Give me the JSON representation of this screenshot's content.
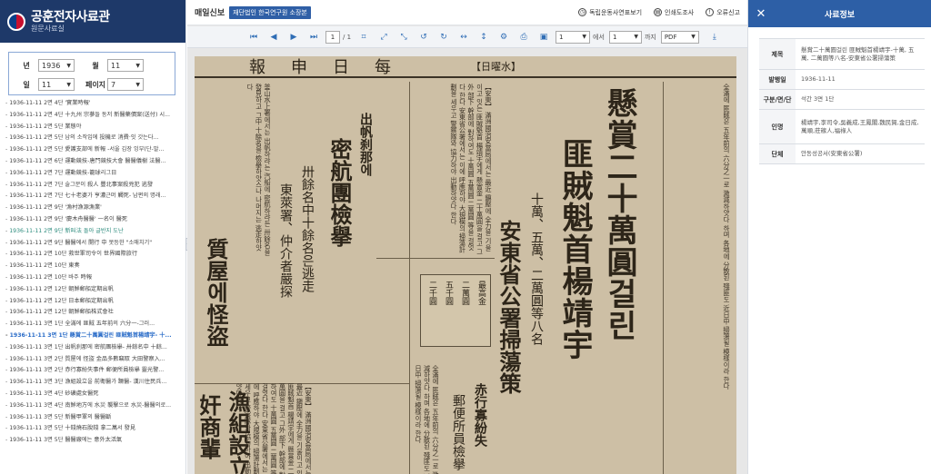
{
  "logo": {
    "title": "공훈전자사료관",
    "subtitle": "원문사료실"
  },
  "filters": {
    "year_label": "년",
    "year_value": "1936",
    "month_label": "월",
    "month_value": "11",
    "day_label": "일",
    "day_value": "11",
    "page_label": "페이지",
    "page_value": "7"
  },
  "articles": [
    {
      "text": "1936-11-11 2면 4단 '實業時報'",
      "state": "normal"
    },
    {
      "text": "1936-11-11 2면 4단 十九州 宗蔘들 동저 新醫藥價案(送付) 시...",
      "state": "normal"
    },
    {
      "text": "1936-11-11 2면 5단 業態야",
      "state": "normal"
    },
    {
      "text": "1936-11-11 2면 5단 남의 소작입에 投機로 消費·잇 갓는다...",
      "state": "normal"
    },
    {
      "text": "1936-11-11 2면 5단 愛護支部에 新報 -서울 김장 잉부(단-말...",
      "state": "normal"
    },
    {
      "text": "1936-11-11 2면 6단 運動競技-唐門競技大會 醫醫儀樹 法醫...",
      "state": "normal"
    },
    {
      "text": "1936-11-11 2면 7단 運動競技-籠球리그日",
      "state": "normal"
    },
    {
      "text": "1936-11-11 2면 7단 술그문이 殺人 豐北事案殺兇犯 逃發",
      "state": "normal"
    },
    {
      "text": "1936-11-11 2면 7단 七十老婆가 亨濃근머 觸死- 남편의 명래...",
      "state": "normal"
    },
    {
      "text": "1936-11-11 2면 9단 '漁村漁源漁業'",
      "state": "normal"
    },
    {
      "text": "1936-11-11 2면 9단 '慶木舟醫醫' 一名이 醫死",
      "state": "normal"
    },
    {
      "text": "1936-11-11 2면 9단 新叫法 돌아 글반지 도난",
      "state": "visited"
    },
    {
      "text": "1936-11-11 2면 9단 醫醫에서 開行 中 못등한 \"소매치기\"",
      "state": "normal"
    },
    {
      "text": "1936-11-11 2면 10단 救世軍司令이 世界國際旅行",
      "state": "normal"
    },
    {
      "text": "1936-11-11 2면 10단 東奏",
      "state": "normal"
    },
    {
      "text": "1936-11-11 2면 10단 바주 時報",
      "state": "normal"
    },
    {
      "text": "1936-11-11 2면 12단 朝鮮郵船定期出帆",
      "state": "normal"
    },
    {
      "text": "1936-11-11 2면 12단 日本郵船定期出帆",
      "state": "normal"
    },
    {
      "text": "1936-11-11 2면 12단 朝鮮郵船株式會社",
      "state": "normal"
    },
    {
      "text": "1936-11-11 3면 1단 全滿에 匪賊 五年前의 六分一-그러...",
      "state": "normal"
    },
    {
      "text": "1936-11-11 3면 1단 懸賞二十萬圓걸린 匪賊魁首楊靖宇- 十...",
      "state": "active"
    },
    {
      "text": "1936-11-11 3면 1단 出帆刹那에 密航團檢擧- 卅餘名中 十餘...",
      "state": "normal"
    },
    {
      "text": "1936-11-11 3면 2단 質屋에 怪盜 金品多數竊取 大田警察入...",
      "state": "normal"
    },
    {
      "text": "1936-11-11 3면 2단 赤行寡紛失事件 郵便所員檢擧 靈光警...",
      "state": "normal"
    },
    {
      "text": "1936-11-11 3면 3단 漁組設立을 前衛醫가 蹶醫- 漢川住民兵...",
      "state": "normal"
    },
    {
      "text": "1936-11-11 3면 4단 砂礦處女醫死",
      "state": "normal"
    },
    {
      "text": "1936-11-11 3면 4단 南鮮地方에 水災 襲撃으로 水災-醫醫의로...",
      "state": "normal"
    },
    {
      "text": "1936-11-11 3면 5단 新醫甲軍의 醫醫斷",
      "state": "normal"
    },
    {
      "text": "1936-11-11 3면 5단 十錢燒石脫錢 拿二萬서 發見",
      "state": "normal"
    },
    {
      "text": "1936-11-11 3면 5단 醫醫廠에는 意外太活氣",
      "state": "normal"
    }
  ],
  "center_header": {
    "paper_name": "매일신보",
    "source_badge": "재단법인 한국연구원 소장본",
    "links": [
      "독립운동사연표보기",
      "인쇄도조사",
      "오류신고"
    ]
  },
  "toolbar": {
    "page_current": "1",
    "page_total": "/ 1",
    "range_from": "1",
    "range_from_label": "에서",
    "range_to": "1",
    "range_to_label": "까지",
    "format": "PDF"
  },
  "newspaper": {
    "masthead_title": "報申日每",
    "masthead_date": "【日曜水】",
    "headline_main": "懸賞二十萬圓걸린",
    "headline_sub": "匪賊魁首楊靖宇",
    "headline_side": "十萬、五萬、二萬圓等八名",
    "headline_side2": "安東省公署掃蕩策",
    "headline_two_main": "密航團檢擧",
    "headline_two_top": "出帆刹那에",
    "headline_two_sub": "卅餘名中十餘名은逃走",
    "headline_two_sub2": "東萊署、仲介者嚴探",
    "headline_three": "質屋에怪盜",
    "headline_four": "赤行寡紛失",
    "headline_four_sub": "郵便所員檢擧",
    "headline_five": "漁組設立",
    "headline_six": "奸商輩",
    "body_text": "【安東】 滿洲國治安當局에서는 最近 鎭壓에 全力을 기울이고 잇는 匪賊魁首 楊靖宇에게 懸賞金 二十萬圓을 걸고 그外 部下 幹部에 對하여도 十萬圓 五萬圓 二萬圓 等을 걸엇다 한다 安東省公署에서는 이에 呼應하야 大規模의 掃蕩計劃을 세우고 警察隊와 協力하야 出動하얏다 한다",
    "body_text_short": "全滿에 匪賊은 五年前의 六分之一로 激減하얏다 하며 各地에 分散된 殘匪도 近日中 掃蕩될 模樣이라 한다",
    "body_text_right": "釜山水上署에서는 出帆하랴는 汽船에 密航하랴든 卅餘名을 發見하고 그中 十餘名을 檢擧하얏스나 나머지는 逃走하얏다",
    "price_rows": [
      "最高金",
      "二萬圓",
      "五千圓",
      "二千圓"
    ]
  },
  "info_panel": {
    "title": "사료정보",
    "rows": [
      {
        "key": "제목",
        "value": "懸賞二十萬圓걸린 匪賊魁首楊靖宇-十萬, 五萬, 二萬圓等八名-安東省公署掃蕩策"
      },
      {
        "key": "발행일",
        "value": "1936-11-11"
      },
      {
        "key": "구분/면/단",
        "value": "석간 3면 1단"
      },
      {
        "key": "인명",
        "value": "楊靖宇,李司令,吳義成,王鳳閣,魏民賀,金日成,萬順,莊稼人,福祿人"
      },
      {
        "key": "단체",
        "value": "안동성공서(安東省公署)"
      }
    ]
  }
}
